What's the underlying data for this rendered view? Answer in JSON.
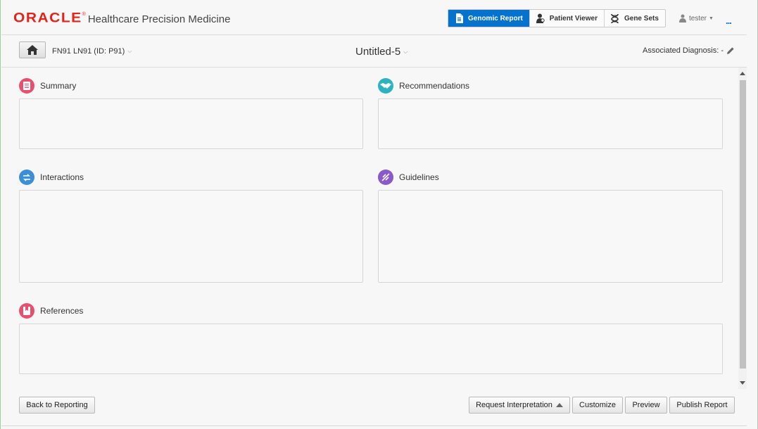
{
  "header": {
    "brand": "ORACLE",
    "brand_mark": "®",
    "product": "Healthcare Precision Medicine",
    "nav": [
      {
        "label": "Genomic Report",
        "icon": "document-icon",
        "active": true
      },
      {
        "label": "Patient Viewer",
        "icon": "patient-icon",
        "active": false
      },
      {
        "label": "Gene Sets",
        "icon": "dna-icon",
        "active": false
      }
    ],
    "user": "tester",
    "more": "..."
  },
  "subheader": {
    "patient": "FN91 LN91 (ID: P91)",
    "report_title": "Untitled-5",
    "diagnosis": "Associated Diagnosis: -"
  },
  "sections": {
    "summary": {
      "label": "Summary",
      "color": "#e84f6d"
    },
    "recommendations": {
      "label": "Recommendations",
      "color": "#2cb3c0"
    },
    "interactions": {
      "label": "Interactions",
      "color": "#3a8fd8"
    },
    "guidelines": {
      "label": "Guidelines",
      "color": "#8b59c7"
    },
    "references": {
      "label": "References",
      "color": "#e84f6d"
    }
  },
  "footer": {
    "back": "Back to Reporting",
    "request": "Request Interpretation",
    "customize": "Customize",
    "preview": "Preview",
    "publish": "Publish Report"
  },
  "colors": {
    "accent": "#0572ce",
    "brand": "#e2231a"
  }
}
